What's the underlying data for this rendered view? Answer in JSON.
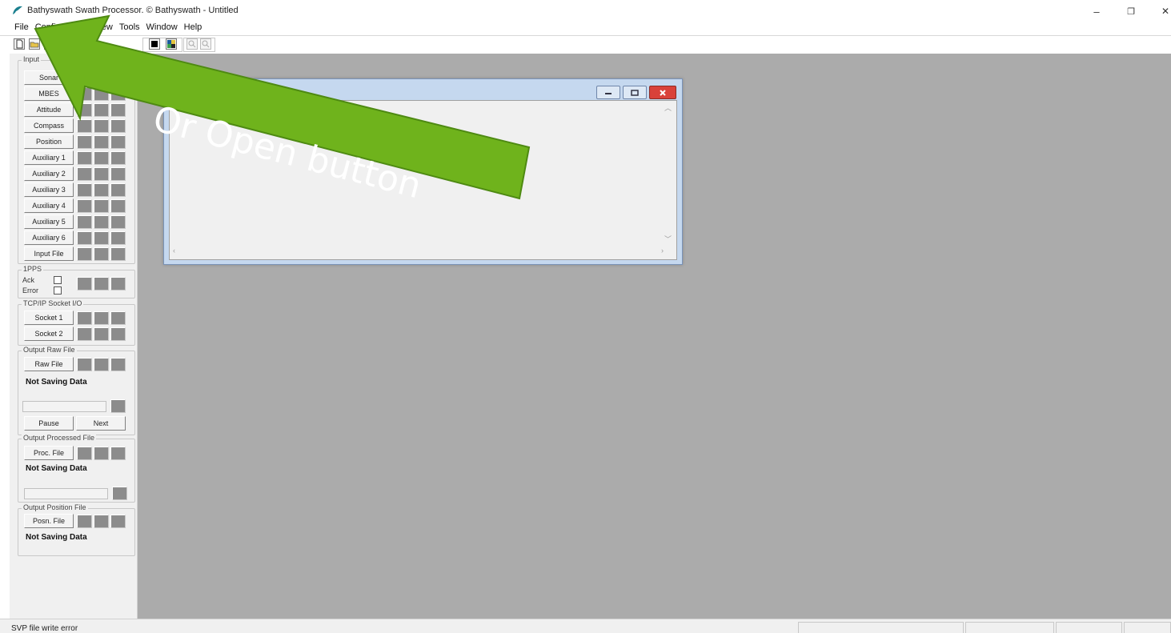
{
  "window": {
    "title": "Bathyswath Swath Processor.  © Bathyswath - Untitled",
    "minimize": "–",
    "restore": "❐",
    "close": "✕"
  },
  "menu": [
    "File",
    "Configuration",
    "View",
    "Tools",
    "Window",
    "Help"
  ],
  "annotation": {
    "text": "Or Open button",
    "color": "#6fb31c"
  },
  "panel": {
    "input": {
      "title": "Input",
      "buttons": [
        "Sonar",
        "MBES",
        "Attitude",
        "Compass",
        "Position",
        "Auxiliary 1",
        "Auxiliary 2",
        "Auxiliary 3",
        "Auxiliary 4",
        "Auxiliary 5",
        "Auxiliary 6",
        "Input File"
      ]
    },
    "pps": {
      "title": "1PPS",
      "ack": "Ack",
      "error": "Error"
    },
    "tcp": {
      "title": "TCP/IP Socket I/O",
      "buttons": [
        "Socket 1",
        "Socket 2"
      ]
    },
    "raw": {
      "title": "Output Raw File",
      "button": "Raw File",
      "status": "Not Saving Data",
      "pause": "Pause",
      "next": "Next"
    },
    "processed": {
      "title": "Output Processed File",
      "button": "Proc. File",
      "status": "Not Saving Data"
    },
    "position": {
      "title": "Output Position File",
      "button": "Posn. File",
      "status": "Not Saving Data"
    }
  },
  "statusbar": {
    "message": "SVP file write error"
  },
  "colors": {
    "mdi_background": "#ababab",
    "indicator": "#8c8c8c",
    "close_button": "#d9413a"
  }
}
